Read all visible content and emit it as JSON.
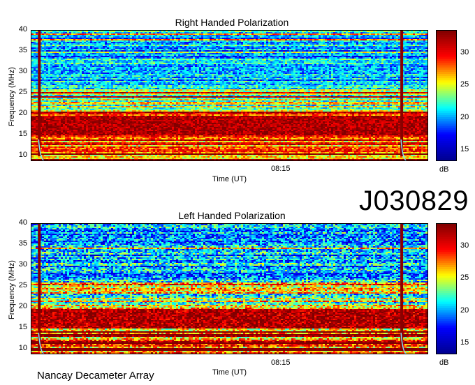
{
  "big_label": "J030829",
  "footer": "Nancay Decameter Array",
  "colorbar": {
    "unit": "dB",
    "ticks": [
      15,
      20,
      25,
      30
    ],
    "min": 13.5,
    "max": 33.5,
    "stops": [
      "#00008f",
      "#0000ff",
      "#00ffff",
      "#ffff00",
      "#ff0000",
      "#800000"
    ]
  },
  "chart_data": [
    {
      "type": "heatmap",
      "title": "Right Handed Polarization",
      "xlabel": "Time (UT)",
      "ylabel": "Frequency (MHz)",
      "x_tick_labels": [
        "08:15"
      ],
      "y_ticks": [
        10,
        15,
        20,
        25,
        30,
        35,
        40
      ],
      "ylim": [
        9,
        40
      ],
      "colorbar_unit": "dB",
      "colorbar_range": [
        13.5,
        33.5
      ],
      "features": {
        "intense_band_mhz": [
          15,
          19.5
        ],
        "vertical_events_fraction_of_time": [
          0.02,
          0.935
        ]
      }
    },
    {
      "type": "heatmap",
      "title": "Left Handed Polarization",
      "xlabel": "Time (UT)",
      "ylabel": "Frequency (MHz)",
      "x_tick_labels": [
        "08:15"
      ],
      "y_ticks": [
        10,
        15,
        20,
        25,
        30,
        35,
        40
      ],
      "ylim": [
        9,
        40
      ],
      "colorbar_unit": "dB",
      "colorbar_range": [
        13.5,
        33.5
      ],
      "features": {
        "intense_band_mhz": [
          15,
          19.5
        ],
        "vertical_events_fraction_of_time": [
          0.02,
          0.935
        ]
      }
    }
  ]
}
